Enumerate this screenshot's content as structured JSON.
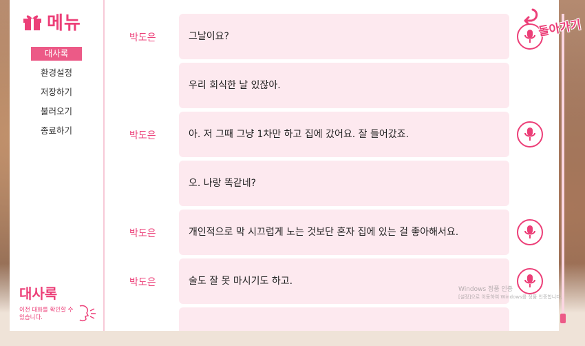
{
  "menu": {
    "title": "메뉴",
    "items": [
      {
        "label": "대사록",
        "active": true
      },
      {
        "label": "환경설정",
        "active": false
      },
      {
        "label": "저장하기",
        "active": false
      },
      {
        "label": "불러오기",
        "active": false
      },
      {
        "label": "종료하기",
        "active": false
      }
    ],
    "footer_title": "대사록",
    "footer_desc": "이전 대화를 확인할 수 있습니다."
  },
  "back_button": {
    "label": "돌아가기"
  },
  "dialog_log": [
    {
      "speaker": "박도은",
      "text": "그날이요?",
      "has_voice": true
    },
    {
      "speaker": "",
      "text": "우리 회식한 날 있잖아.",
      "has_voice": false
    },
    {
      "speaker": "박도은",
      "text": "아. 저 그때 그냥 1차만 하고 집에 갔어요. 잘 들어갔죠.",
      "has_voice": true
    },
    {
      "speaker": "",
      "text": "오. 나랑 똑같네?",
      "has_voice": false
    },
    {
      "speaker": "박도은",
      "text": "개인적으로 막 시끄럽게 노는 것보단 혼자 집에 있는 걸 좋아해서요.",
      "has_voice": true
    },
    {
      "speaker": "박도은",
      "text": "술도 잘 못 마시기도 하고.",
      "has_voice": true
    }
  ],
  "watermark": {
    "line1": "Windows 정품 인증",
    "line2": "[설정]으로 이동하여 Windows를 정품 인증합니다."
  },
  "colors": {
    "accent": "#ec3f78",
    "bubble": "#fde9ef"
  }
}
